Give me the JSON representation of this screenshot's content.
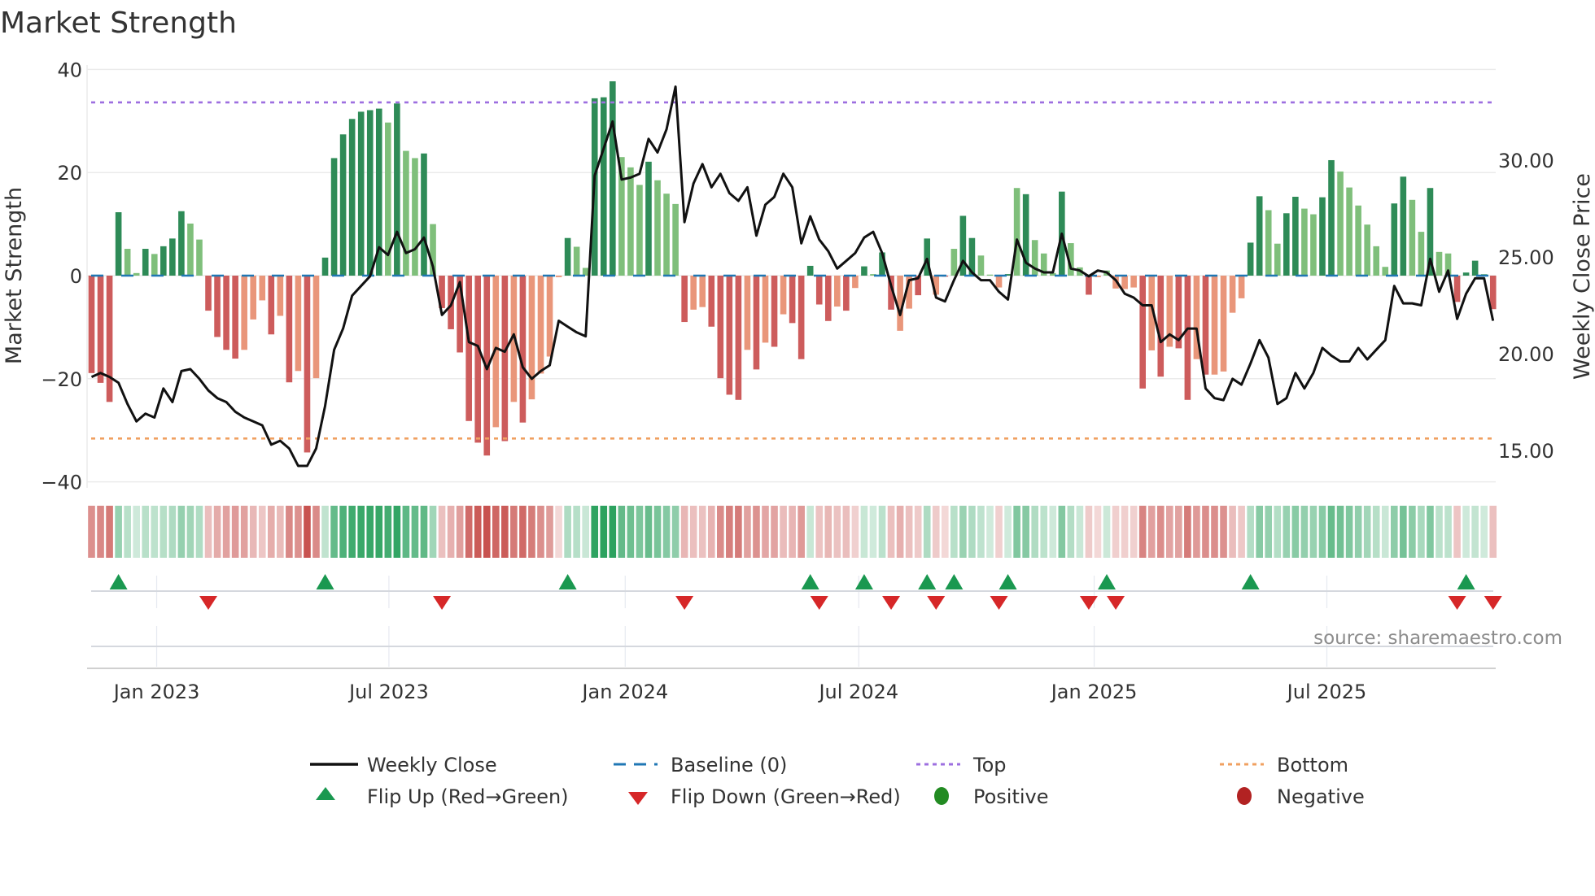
{
  "chart_data": {
    "type": "bar",
    "title": "Market Strength",
    "ylabel": "Market Strength",
    "ylabel_right": "Weekly Close Price",
    "ylim": [
      -44,
      41
    ],
    "ylim_right": [
      11.2,
      35.5
    ],
    "yticks": [
      "40",
      "20",
      "0",
      "−20",
      "−40"
    ],
    "ytick_values": [
      40,
      20,
      0,
      -20,
      -40
    ],
    "yticks_right": [
      "30.00",
      "25.00",
      "20.00",
      "15.00"
    ],
    "ytick_right_values": [
      30,
      25,
      20,
      15
    ],
    "x_unit": "week index",
    "xticks": [
      {
        "label": "Jan 2023",
        "week": 7.25
      },
      {
        "label": "Jul 2023",
        "week": 33.1
      },
      {
        "label": "Jan 2024",
        "week": 59.4
      },
      {
        "label": "Jul 2024",
        "week": 85.4
      },
      {
        "label": "Jan 2025",
        "week": 111.6
      },
      {
        "label": "Jul 2025",
        "week": 137.5
      }
    ],
    "top_level": 33.6,
    "bottom_level": -31.6,
    "baseline": 0,
    "strength": [
      -18.9,
      -20.8,
      -24.5,
      12.3,
      5.2,
      0.5,
      5.2,
      4.2,
      5.7,
      7.2,
      12.5,
      10.1,
      7.0,
      -6.8,
      -11.9,
      -14.4,
      -16.1,
      -14.4,
      -8.5,
      -4.8,
      -11.4,
      -7.8,
      -20.7,
      -18.5,
      -34.3,
      -19.9,
      3.5,
      22.8,
      27.4,
      30.4,
      31.8,
      32.1,
      32.4,
      29.7,
      33.4,
      24.2,
      22.8,
      23.7,
      10.0,
      -6.3,
      -10.4,
      -14.9,
      -28.2,
      -32.4,
      -34.9,
      -29.4,
      -32.1,
      -24.5,
      -28.5,
      -24.0,
      -19.0,
      -15.7,
      -0.3,
      7.3,
      5.6,
      1.5,
      34.4,
      34.6,
      37.7,
      23.0,
      21.0,
      17.6,
      22.1,
      18.5,
      15.9,
      13.9,
      -9.0,
      -6.6,
      -6.1,
      -9.9,
      -19.9,
      -23.1,
      -24.1,
      -14.4,
      -18.2,
      -13.0,
      -13.8,
      -7.5,
      -9.2,
      -16.2,
      1.9,
      -5.6,
      -8.8,
      -6.0,
      -6.8,
      -2.4,
      1.8,
      0.3,
      4.5,
      -6.6,
      -10.7,
      -6.4,
      -3.8,
      7.2,
      -3.7,
      -0.2,
      5.2,
      11.6,
      7.3,
      3.9,
      0.2,
      -2.3,
      0.3,
      17.0,
      15.8,
      6.9,
      4.3,
      0.5,
      16.3,
      6.3,
      1.6,
      -3.7,
      -0.3,
      1.0,
      -2.5,
      -2.6,
      -2.3,
      -21.9,
      -14.5,
      -19.6,
      -13.8,
      -14.1,
      -24.1,
      -16.2,
      -19.2,
      -19.2,
      -18.6,
      -7.2,
      -4.4,
      6.4,
      15.4,
      12.7,
      6.2,
      12.1,
      15.3,
      13.0,
      11.9,
      15.2,
      22.4,
      20.2,
      17.1,
      13.6,
      9.9,
      5.7,
      1.7,
      14.0,
      19.2,
      14.7,
      8.5,
      17.0,
      4.6,
      4.3,
      -5.1,
      0.6,
      2.9,
      0.3,
      -6.5
    ],
    "strength_shade": "DDDDLLDLDDDLLDDDDLLLDLDLDLDDDDDDDLDLLDLDDDDDDLDLDLLLLDLLDDDLLLDLLLDLLDDDDLDLDLDDDDDLDLDLDDLLDDLDLDDLLLDLDLLLDLLDLLLLLDLDLDDLDLLLLDDLLDDLLDDLLLLLLDDLLDLLDDDLD",
    "weekly_close": [
      18.8,
      19.0,
      18.8,
      18.5,
      17.4,
      16.5,
      16.9,
      16.7,
      18.2,
      17.5,
      19.1,
      19.2,
      18.7,
      18.1,
      17.7,
      17.5,
      17.0,
      16.7,
      16.5,
      16.3,
      15.3,
      15.5,
      15.1,
      14.2,
      14.2,
      15.1,
      17.3,
      20.2,
      21.3,
      23.0,
      23.5,
      24.0,
      25.5,
      25.1,
      26.3,
      25.2,
      25.4,
      26.0,
      24.5,
      22.0,
      22.5,
      23.7,
      20.6,
      20.4,
      19.2,
      20.3,
      20.1,
      21.0,
      19.3,
      18.7,
      19.1,
      19.4,
      21.7,
      21.4,
      21.1,
      20.9,
      29.2,
      30.6,
      32.0,
      29.0,
      29.1,
      29.3,
      31.1,
      30.4,
      31.6,
      33.8,
      26.8,
      28.8,
      29.8,
      28.6,
      29.3,
      28.3,
      27.9,
      28.6,
      26.1,
      27.7,
      28.1,
      29.3,
      28.6,
      25.7,
      27.1,
      25.9,
      25.3,
      24.4,
      24.8,
      25.2,
      26.0,
      26.3,
      25.2,
      23.5,
      22.0,
      23.8,
      23.9,
      24.9,
      22.9,
      22.7,
      23.8,
      24.8,
      24.2,
      23.8,
      23.8,
      23.2,
      22.8,
      25.9,
      24.7,
      24.4,
      24.2,
      24.2,
      26.2,
      24.4,
      24.3,
      24.0,
      24.3,
      24.2,
      23.8,
      23.1,
      22.9,
      22.5,
      22.5,
      20.6,
      21.0,
      20.7,
      21.3,
      21.3,
      18.2,
      17.7,
      17.6,
      18.7,
      18.4,
      19.5,
      20.7,
      19.8,
      17.4,
      17.7,
      19.0,
      18.2,
      19.0,
      20.3,
      19.9,
      19.6,
      19.6,
      20.3,
      19.7,
      20.2,
      20.7,
      23.5,
      22.6,
      22.6,
      22.5,
      24.9,
      23.2,
      24.3,
      21.8,
      23.1,
      23.9,
      23.9,
      21.7
    ],
    "flip_up_weeks": [
      3,
      26,
      53,
      80,
      86,
      93,
      96,
      102,
      113,
      129,
      153
    ],
    "flip_down_weeks": [
      13,
      39,
      66,
      81,
      89,
      94,
      101,
      111,
      114,
      152,
      156
    ],
    "colors": {
      "strong_green": "#2e8b57",
      "weak_green": "#7fbf7b",
      "strong_red": "#cd5c5c",
      "weak_red": "#e9967a",
      "line": "#111111",
      "baseline": "#1f77b4",
      "top": "#9d6fe0",
      "bottom": "#f0a060",
      "flip_up": "#1a9850",
      "flip_down": "#d62728",
      "positive": "#228b22",
      "negative": "#b22222"
    },
    "legend": {
      "placement": "bottom",
      "weekly_close": "Weekly Close",
      "baseline": "Baseline (0)",
      "top": "Top",
      "bottom": "Bottom",
      "flip_up": "Flip Up (Red→Green)",
      "flip_down": "Flip Down (Green→Red)",
      "positive": "Positive",
      "negative": "Negative"
    },
    "source": "source: sharemaestro.com"
  }
}
